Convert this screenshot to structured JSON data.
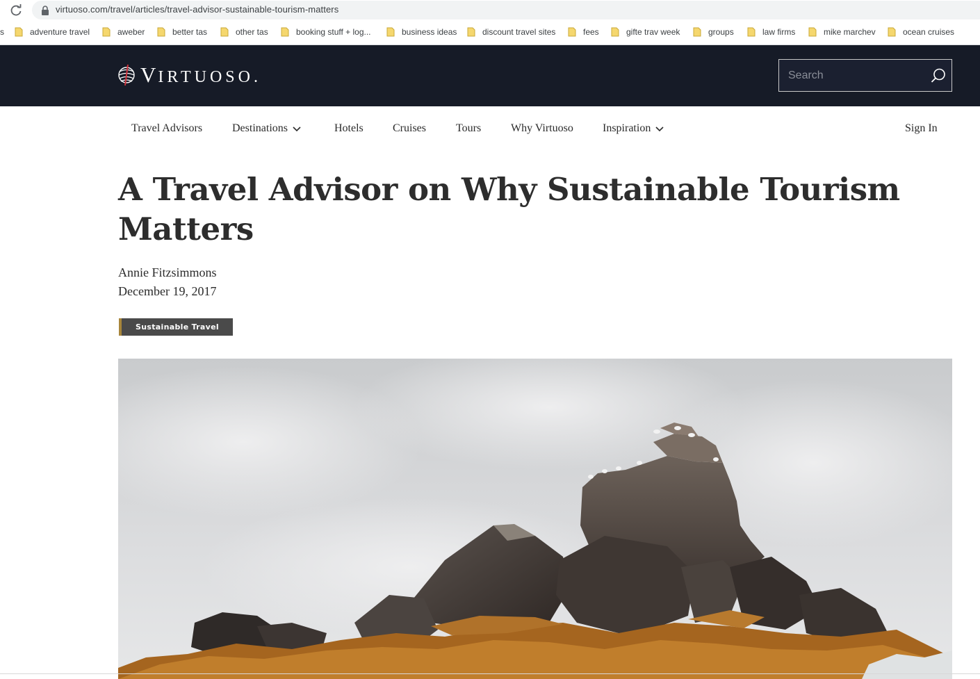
{
  "browser": {
    "url": "virtuoso.com/travel/articles/travel-advisor-sustainable-tourism-matters",
    "bookmark_edge": "s",
    "bookmarks": [
      {
        "label": "adventure travel"
      },
      {
        "label": "aweber"
      },
      {
        "label": "better tas"
      },
      {
        "label": "other tas"
      },
      {
        "label": "booking stuff + log..."
      },
      {
        "label": "business ideas"
      },
      {
        "label": "discount travel sites"
      },
      {
        "label": "fees"
      },
      {
        "label": "gifte trav week"
      },
      {
        "label": "groups"
      },
      {
        "label": "law firms"
      },
      {
        "label": "mike marchev"
      },
      {
        "label": "ocean cruises"
      }
    ]
  },
  "header": {
    "logo_first": "V",
    "logo_rest": "IRTUOSO",
    "logo_dot": ".",
    "search_placeholder": "Search"
  },
  "nav": {
    "items": [
      {
        "label": "Travel Advisors"
      },
      {
        "label": "Destinations"
      },
      {
        "label": "Hotels"
      },
      {
        "label": "Cruises"
      },
      {
        "label": "Tours"
      },
      {
        "label": "Why Virtuoso"
      },
      {
        "label": "Inspiration"
      }
    ],
    "sign_in": "Sign In"
  },
  "article": {
    "title": "A Travel Advisor on Why Sustainable Tourism Matters",
    "author": "Annie Fitzsimmons",
    "date": "December 19, 2017",
    "tag": "Sustainable Travel"
  },
  "colors": {
    "header_bg": "#161b27",
    "tag_bg": "#4a4a4a",
    "tag_accent": "#a8863b"
  }
}
